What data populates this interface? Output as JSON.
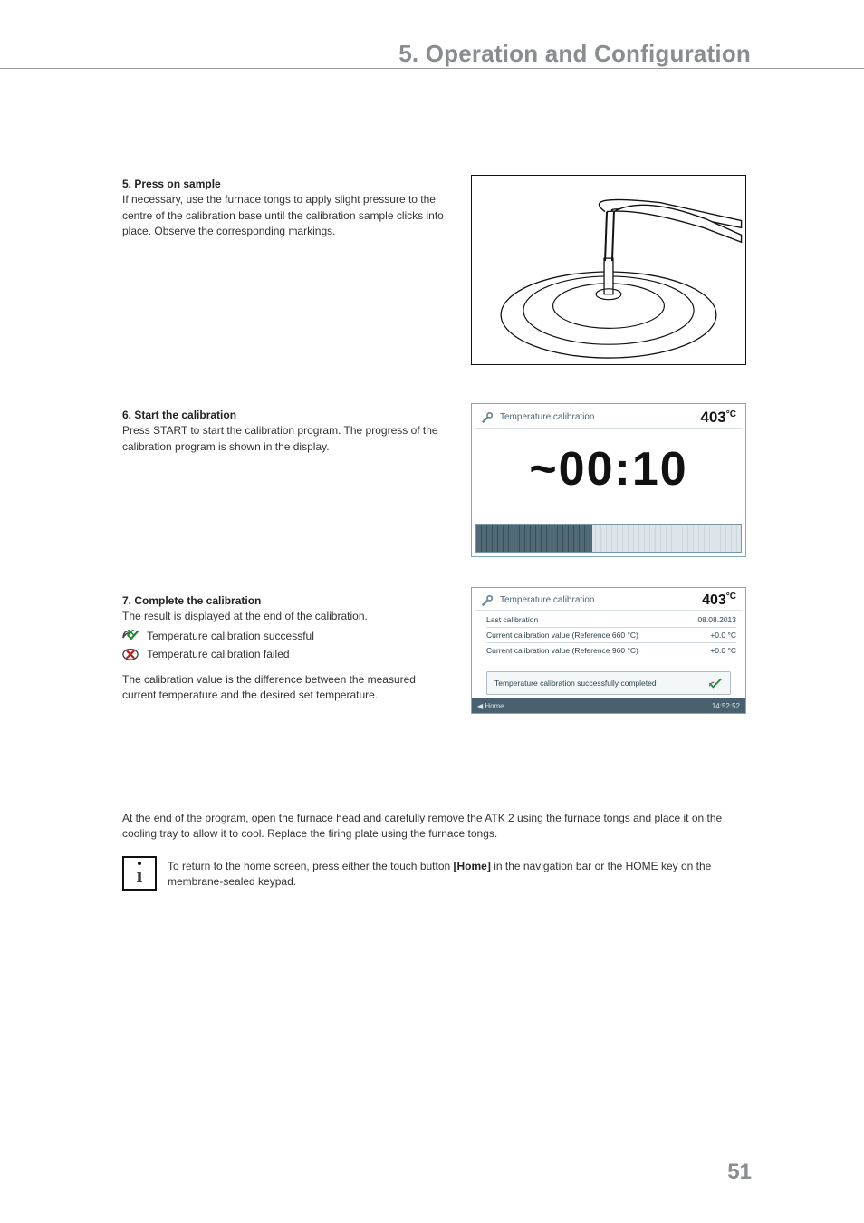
{
  "page": {
    "chapter_title": "5. Operation and Configuration",
    "number": "51"
  },
  "step5": {
    "heading": "5. Press on sample",
    "body": "If necessary, use the furnace tongs to apply slight pressure to the centre of the calibration base until the calibration sample clicks into place. Observe the corresponding markings."
  },
  "step6": {
    "heading": "6. Start the calibration",
    "body": "Press START to start the calibration program. The progress of the calibration program is shown in the display."
  },
  "step7": {
    "heading": "7. Complete the calibration",
    "line1": "The result is displayed at the end of the calibration.",
    "success_label": "Temperature calibration successful",
    "failed_label": "Temperature calibration failed",
    "line2": "The calibration value is the difference between the measured current temperature and the desired set temperature."
  },
  "bottom": {
    "para": "At the end of the program, open the furnace head and carefully remove the ATK 2 using the furnace tongs and place it on the cooling tray to allow it to cool. Replace the firing plate using the furnace tongs.",
    "info_pre": "To return to the home screen, press either the touch button ",
    "info_bold": "[Home]",
    "info_post": " in the navigation bar or the HOME key on the membrane-sealed keypad."
  },
  "screen_progress": {
    "title": "Temperature calibration",
    "device": "403",
    "unit": "°C",
    "time": "~00:10"
  },
  "screen_result": {
    "title": "Temperature calibration",
    "device": "403",
    "unit": "°C",
    "rows": {
      "r1_label": "Last calibration",
      "r1_value": "08.08.2013",
      "r2_label": "Current calibration value (Reference 660 °C)",
      "r2_value": "+0.0 °C",
      "r3_label": "Current calibration value (Reference 960 °C)",
      "r3_value": "+0.0 °C"
    },
    "message": "Temperature calibration successfully completed",
    "home_btn": "Home",
    "clock": "14:52:52"
  },
  "icons": {
    "check": "check-icon",
    "cross": "cross-icon",
    "wrench": "wrench-icon",
    "info": "info-icon",
    "home": "home-icon"
  }
}
